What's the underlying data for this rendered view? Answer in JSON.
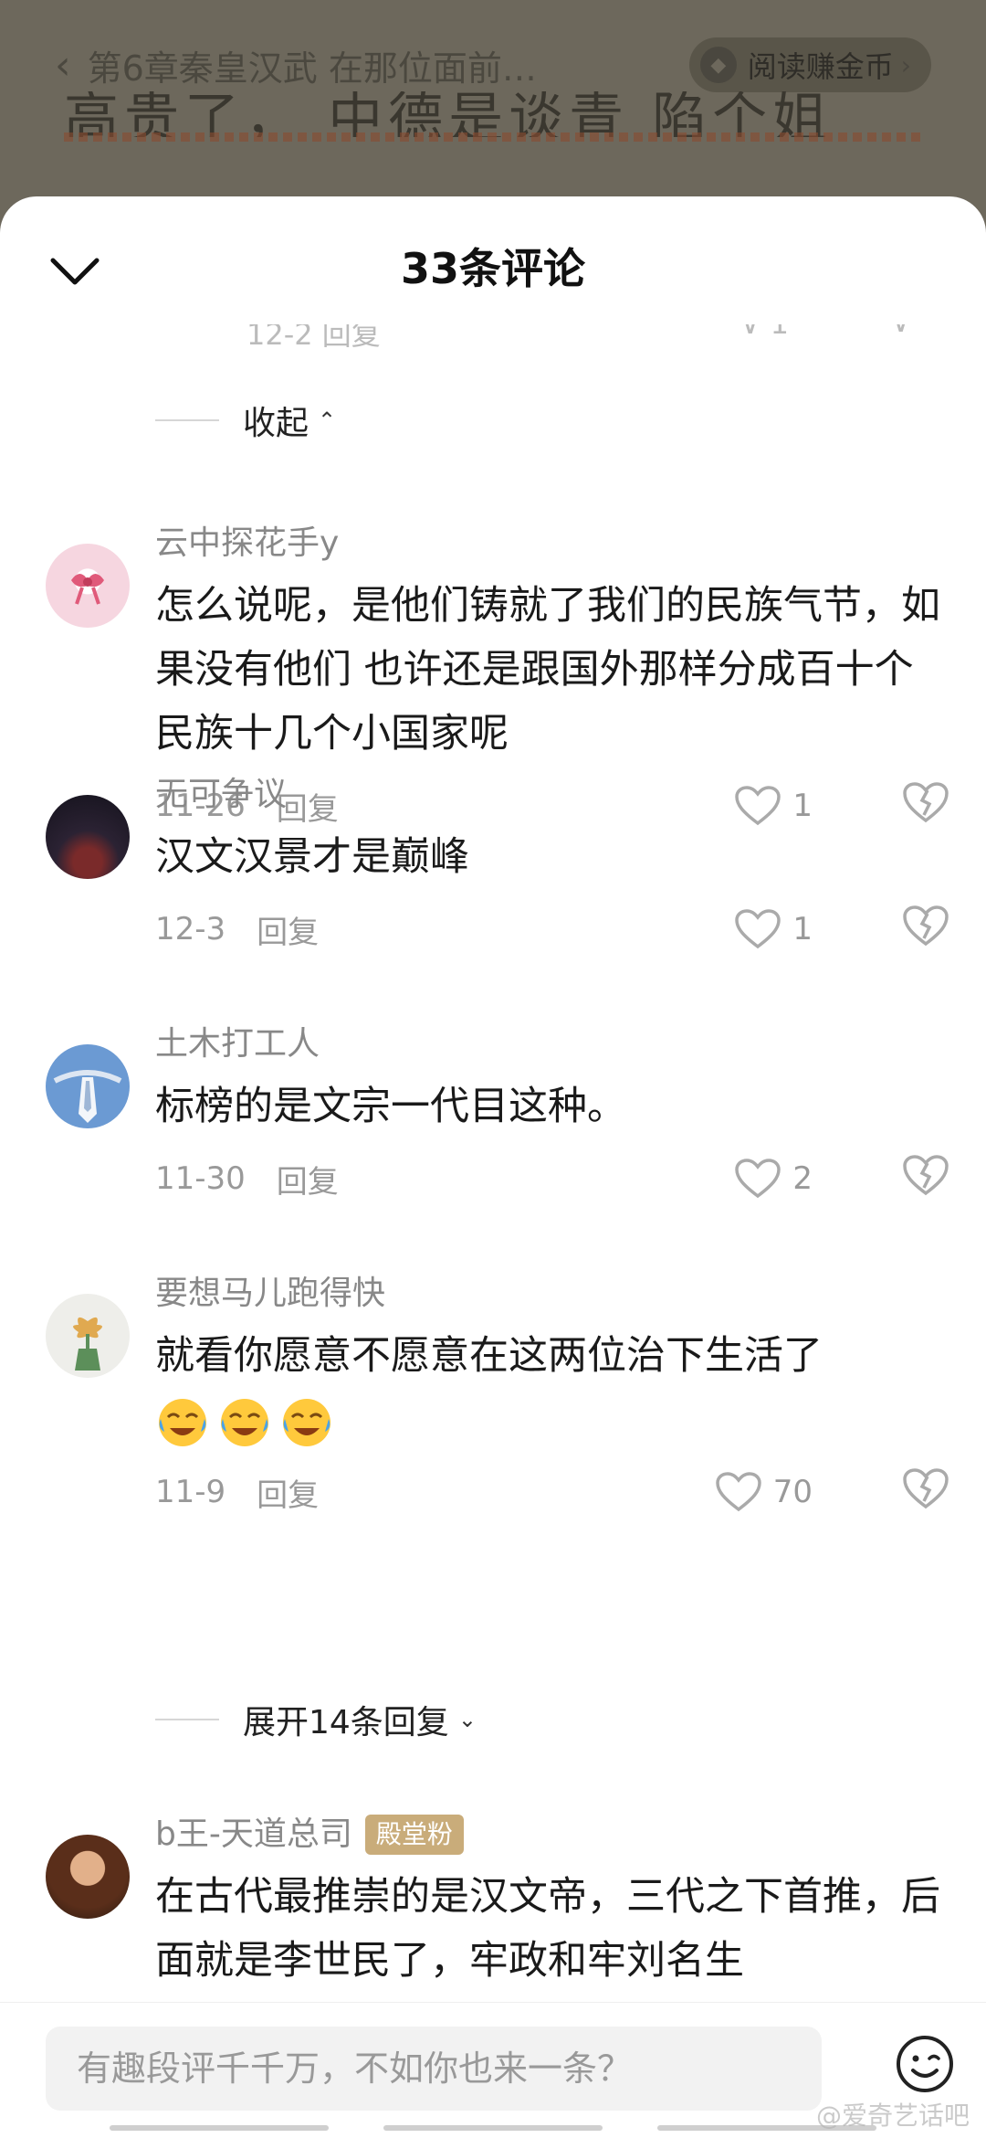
{
  "reader": {
    "chapter_title": "第6章秦皇汉武 在那位面前…",
    "coins_label": "阅读赚金币",
    "body_excerpt": "高贵了，  中德是谈青  陷个姐"
  },
  "comments_panel": {
    "title": "33条评论",
    "fold_label": "收起",
    "partial_date": "12-2",
    "partial_reply": "回复"
  },
  "comments": [
    {
      "username": "云中探花手y",
      "text": "怎么说呢，是他们铸就了我们的民族气节，如果没有他们 也许还是跟国外那样分成百十个民族十几个小国家呢",
      "date": "11-26",
      "reply_label": "回复",
      "likes": "1"
    },
    {
      "username": "无可争议",
      "text": "汉文汉景才是巅峰",
      "date": "12-3",
      "reply_label": "回复",
      "likes": "1"
    },
    {
      "username": "土木打工人",
      "text": "标榜的是文宗一代目这种。",
      "date": "11-30",
      "reply_label": "回复",
      "likes": "2"
    },
    {
      "username": "要想马儿跑得快",
      "text": "就看你愿意不愿意在这两位治下生活了",
      "date": "11-9",
      "reply_label": "回复",
      "likes": "70",
      "expand_label": "展开14条回复"
    },
    {
      "username": "b王-天道总司",
      "badge": "殿堂粉",
      "text": "在古代最推崇的是汉文帝，三代之下首推，后面就是李世民了，牢政和牢刘名生"
    }
  ],
  "input": {
    "placeholder": "有趣段评千千万，不如你也来一条？"
  },
  "watermark": "@爱奇艺话吧",
  "colors": {
    "badge": "#c9ac7a",
    "accent_text": "#1a1a1a",
    "meta_text": "#999999"
  }
}
